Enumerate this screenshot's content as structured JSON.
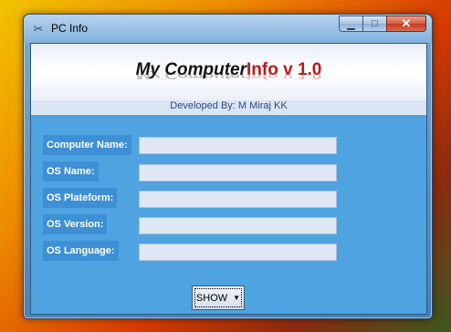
{
  "window": {
    "title": "PC Info",
    "icon": "tools-icon",
    "minimize_glyph": "▁",
    "maximize_glyph": "□",
    "close_glyph": "✕"
  },
  "banner": {
    "title_part_a": "My Computer",
    "title_part_b": "Info v 1.0",
    "developer": "Developed By: M Miraj KK"
  },
  "fields": [
    {
      "label": "Computer Name:",
      "value": ""
    },
    {
      "label": "OS Name:",
      "value": ""
    },
    {
      "label": "OS Plateform:",
      "value": ""
    },
    {
      "label": "OS Version:",
      "value": ""
    },
    {
      "label": "OS Language:",
      "value": ""
    }
  ],
  "show_button": {
    "label": "SHOW",
    "dropdown_glyph": "▼"
  },
  "colors": {
    "client_bg": "#4fa3e0",
    "label_bg": "#3d8fd6",
    "title_accent": "#b81818"
  }
}
